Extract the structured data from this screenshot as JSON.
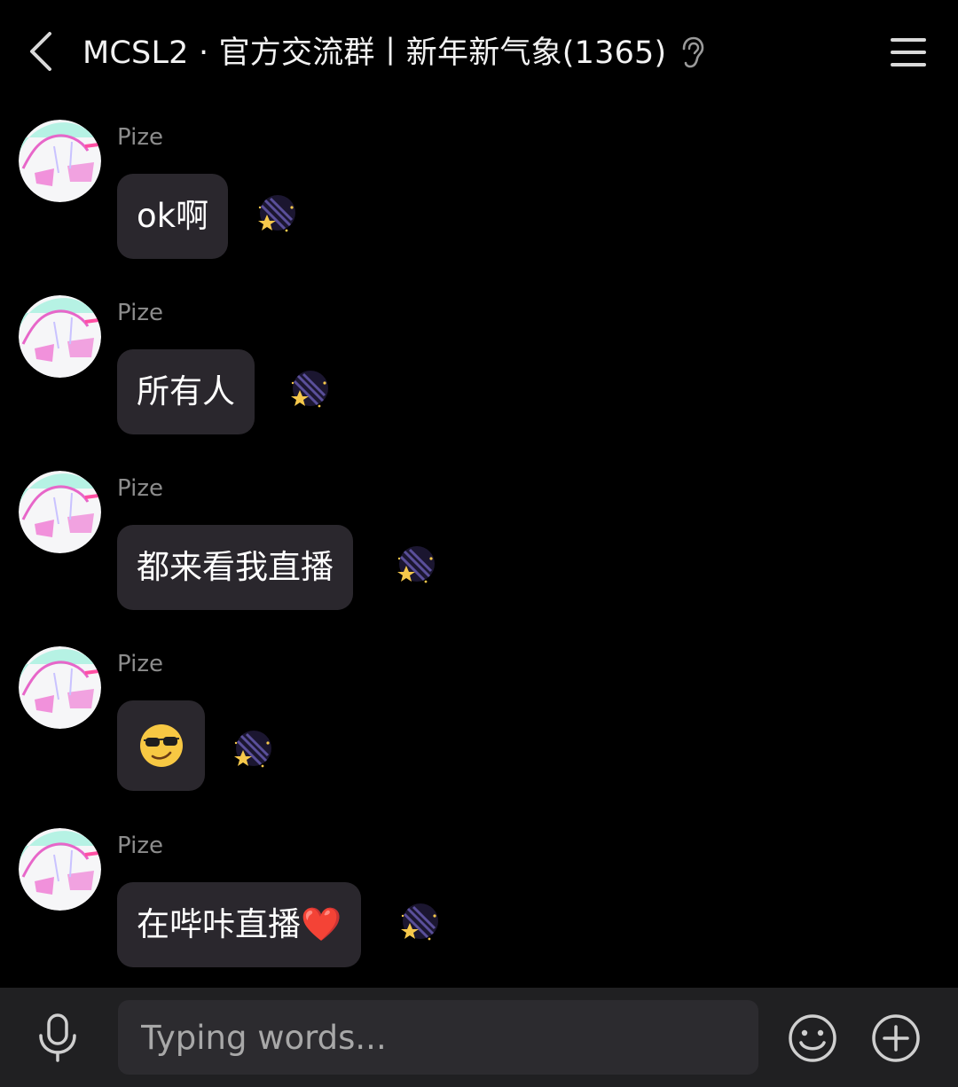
{
  "header": {
    "title": "MCSL2 · 官方交流群丨新年新气象(1365)",
    "back_icon": "chevron-left-icon",
    "ear_icon": "ear-icon",
    "menu_icon": "hamburger-menu-icon"
  },
  "messages": [
    {
      "sender": "Pize",
      "text": "ok啊",
      "type": "text"
    },
    {
      "sender": "Pize",
      "text": "所有人",
      "type": "text"
    },
    {
      "sender": "Pize",
      "text": "都来看我直播",
      "type": "text"
    },
    {
      "sender": "Pize",
      "text": "😏",
      "type": "emoji"
    },
    {
      "sender": "Pize",
      "text": "在哔咔直播❤️",
      "type": "text"
    }
  ],
  "input": {
    "placeholder": "Typing words...",
    "mic_icon": "microphone-icon",
    "emoji_icon": "smiley-icon",
    "add_icon": "plus-circle-icon"
  },
  "colors": {
    "background": "#000000",
    "bubble": "#2a272d",
    "input_bar": "#202022",
    "sender": "#8c8c8c"
  }
}
